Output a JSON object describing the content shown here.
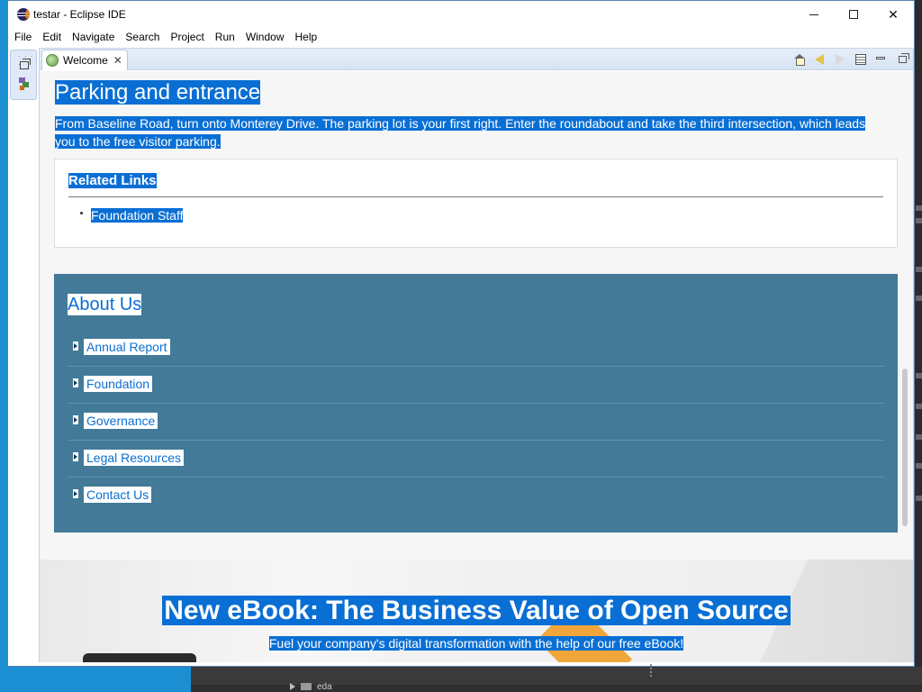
{
  "window": {
    "title": "testar - Eclipse IDE",
    "minimize_glyph": "",
    "close_glyph": "✕"
  },
  "menu": [
    "File",
    "Edit",
    "Navigate",
    "Search",
    "Project",
    "Run",
    "Window",
    "Help"
  ],
  "editor": {
    "tab_label": "Welcome",
    "tab_close": "✕",
    "toolbar_icons": [
      "home-icon",
      "back-icon",
      "forward-icon",
      "table-of-contents-icon",
      "minimize-icon",
      "maximize-icon"
    ]
  },
  "content": {
    "parking_heading": "Parking and entrance",
    "parking_text": "From Baseline Road, turn onto Monterey Drive. The parking lot is your first right. Enter the roundabout and take the third intersection, which leads you to the free visitor parking.",
    "related_title": "Related Links",
    "related_links": [
      "Foundation Staff"
    ],
    "about_title": "About Us",
    "about_links": [
      "Annual Report",
      "Foundation",
      "Governance",
      "Legal Resources",
      "Contact Us"
    ],
    "banner_title": "New eBook: The Business Value of Open Source",
    "banner_subtitle": "Fuel your company's digital transformation with the help of our free eBook!"
  },
  "taskbar": {
    "item_label": "eda"
  },
  "colors": {
    "selection": "#0a6fd4",
    "about_panel": "#427a98",
    "desktop": "#1b8fd1"
  }
}
